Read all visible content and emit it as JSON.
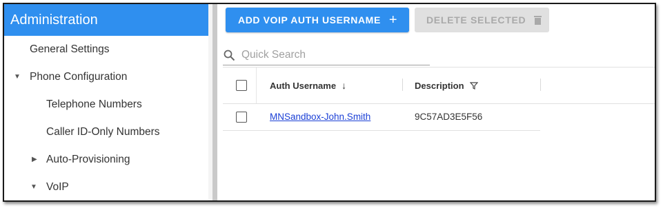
{
  "sidebar": {
    "title": "Administration",
    "items": [
      {
        "label": "General Settings"
      },
      {
        "label": "Phone Configuration"
      },
      {
        "label": "Telephone Numbers"
      },
      {
        "label": "Caller ID-Only Numbers"
      },
      {
        "label": "Auto-Provisioning"
      },
      {
        "label": "VoIP"
      }
    ]
  },
  "toolbar": {
    "add_label": "ADD VOIP AUTH USERNAME",
    "add_icon": "+",
    "delete_label": "DELETE SELECTED",
    "delete_icon": "trash-icon"
  },
  "search": {
    "placeholder": "Quick Search"
  },
  "table": {
    "columns": [
      {
        "label": "Auth Username",
        "icon": "↓"
      },
      {
        "label": "Description",
        "icon": "filter-icon"
      }
    ],
    "rows": [
      {
        "auth_username": "MNSandbox-John.Smith",
        "description": "9C57AD3E5F56"
      }
    ]
  },
  "colors": {
    "accent": "#2f8fef",
    "link": "#1a3fd6",
    "disabled_bg": "#e0e0e0",
    "disabled_text": "#a9a9a9"
  }
}
